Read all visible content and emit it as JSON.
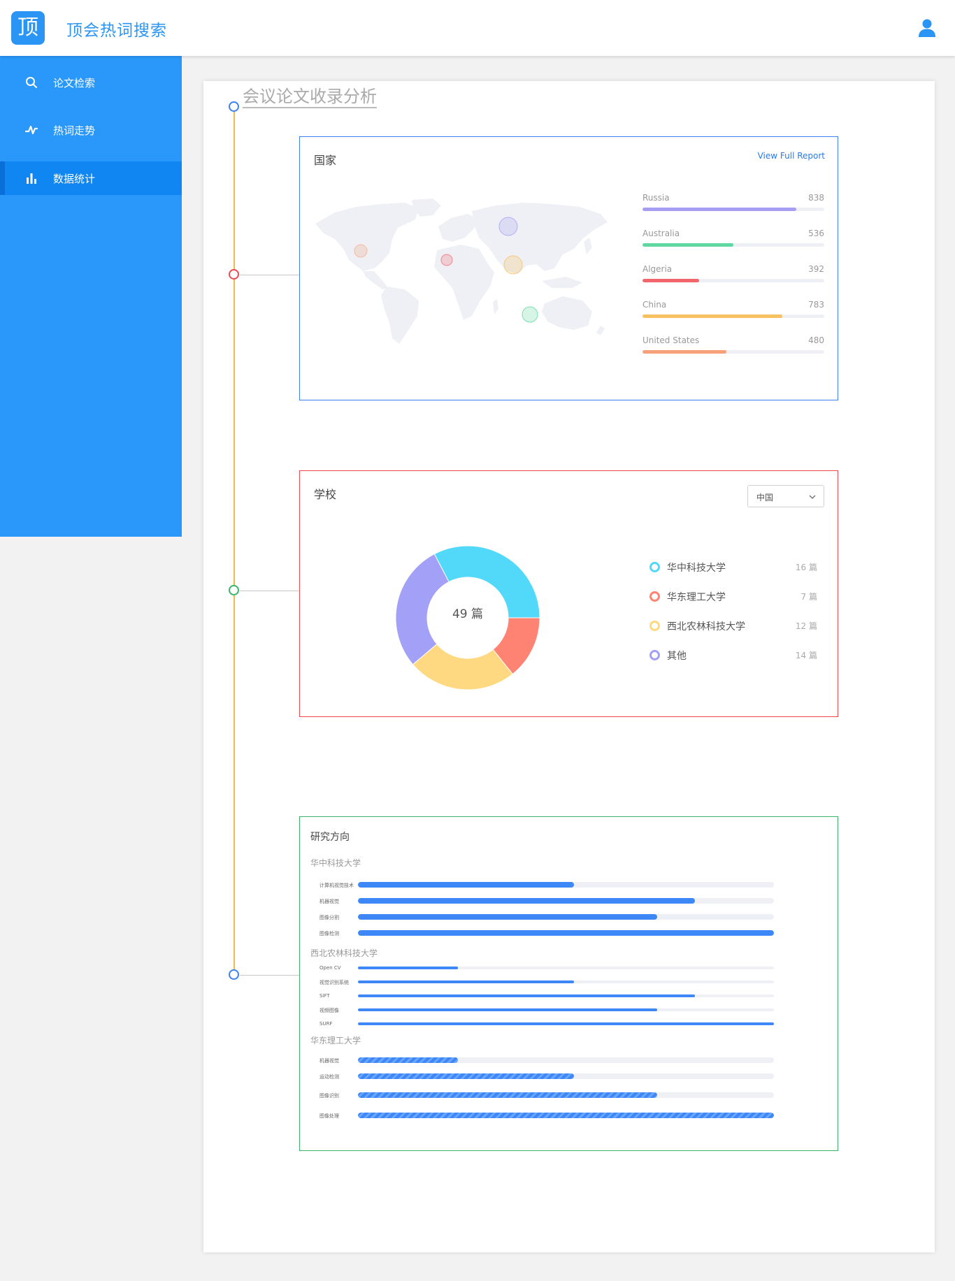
{
  "header": {
    "logo_char": "顶",
    "title": "顶会热词搜索"
  },
  "sidebar": {
    "items": [
      {
        "label": "论文检索",
        "icon": "search-icon",
        "active": false
      },
      {
        "label": "热词走势",
        "icon": "trend-icon",
        "active": false
      },
      {
        "label": "数据统计",
        "icon": "bar-chart-icon",
        "active": true
      }
    ]
  },
  "main": {
    "section_title": "会议论文收录分析",
    "country_panel": {
      "title": "国家",
      "link": "View Full Report",
      "countries": [
        {
          "name": "Russia",
          "value": "838",
          "color": "#a59ef2",
          "ratio": 0.846
        },
        {
          "name": "Australia",
          "value": "536",
          "color": "#5ed8a0",
          "ratio": 0.5
        },
        {
          "name": "Algeria",
          "value": "392",
          "color": "#f2656b",
          "ratio": 0.31
        },
        {
          "name": "China",
          "value": "783",
          "color": "#f7c15f",
          "ratio": 0.77
        },
        {
          "name": "United States",
          "value": "480",
          "color": "#f7a07a",
          "ratio": 0.46
        }
      ]
    },
    "school_panel": {
      "title": "学校",
      "select_value": "中国",
      "center_text": "49 篇",
      "schools": [
        {
          "name": "华中科技大学",
          "count": "16 篇",
          "color": "#52d9fa"
        },
        {
          "name": "华东理工大学",
          "count": "7 篇",
          "color": "#ff8373"
        },
        {
          "name": "西北农林科技大学",
          "count": "12 篇",
          "color": "#ffd981"
        },
        {
          "name": "其他",
          "count": "14 篇",
          "color": "#a3a0f7"
        }
      ]
    },
    "research_panel": {
      "title": "研究方向",
      "groups": [
        {
          "name": "华中科技大学",
          "items": [
            {
              "label": "计算机视觉技术",
              "value": 0.52
            },
            {
              "label": "机器视觉",
              "value": 0.81
            },
            {
              "label": "图像分割",
              "value": 0.72
            },
            {
              "label": "图像检测",
              "value": 1.0
            }
          ]
        },
        {
          "name": "西北农林科技大学",
          "items": [
            {
              "label": "Open CV",
              "value": 0.24
            },
            {
              "label": "视觉识别系统",
              "value": 0.52
            },
            {
              "label": "SIFT",
              "value": 0.81
            },
            {
              "label": "视频图像",
              "value": 0.72
            },
            {
              "label": "SURF",
              "value": 1.0
            }
          ]
        },
        {
          "name": "华东理工大学",
          "items": [
            {
              "label": "机器视觉",
              "value": 0.24
            },
            {
              "label": "运动检测",
              "value": 0.52
            },
            {
              "label": "图像识别",
              "value": 0.72
            },
            {
              "label": "图像处理",
              "value": 1.0
            }
          ]
        }
      ]
    }
  },
  "colors": {
    "primary": "#2a95f4",
    "timeline": "#f3b940",
    "panel_blue": "#3b82f0",
    "panel_red": "#f0494f",
    "panel_green": "#39b56a",
    "bar_blue": "#3d87f6"
  }
}
